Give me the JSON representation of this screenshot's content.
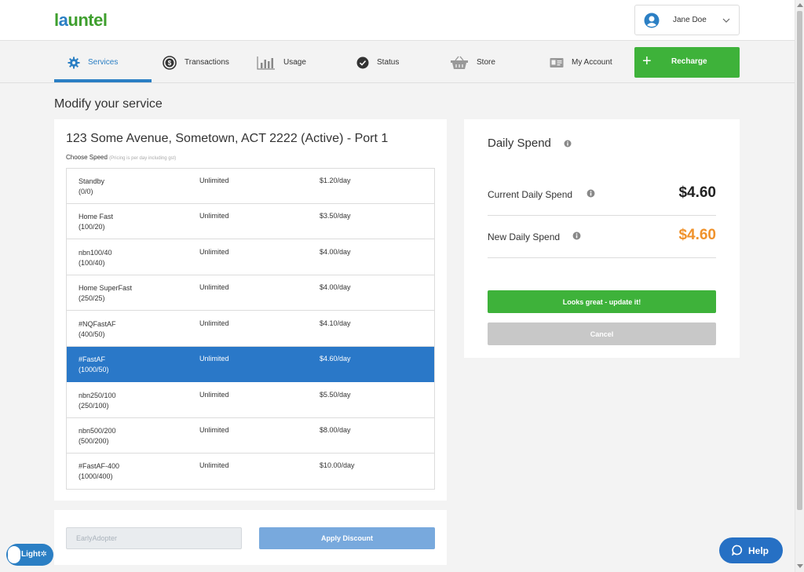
{
  "app": {
    "logo_l": "l",
    "logo_u": "a",
    "logo_rest": "untel"
  },
  "user": {
    "name": "Jane Doe"
  },
  "nav": {
    "items": [
      {
        "label": "Services",
        "icon": "gear-icon"
      },
      {
        "label": "Transactions",
        "icon": "dollar-icon"
      },
      {
        "label": "Usage",
        "icon": "bar-chart-icon"
      },
      {
        "label": "Status",
        "icon": "check-circle-icon"
      },
      {
        "label": "Store",
        "icon": "basket-icon"
      },
      {
        "label": "My Account",
        "icon": "id-card-icon"
      }
    ],
    "recharge_label": "Recharge"
  },
  "page": {
    "title": "Modify your service"
  },
  "service": {
    "address": "123 Some Avenue, Sometown, ACT 2222 (Active) - Port 1",
    "choose_label": "Choose Speed",
    "choose_note": "(Pricing is per day including gst)",
    "speeds": [
      {
        "name": "Standby",
        "speed": "(0/0)",
        "limit": "Unlimited",
        "price": "$1.20/day",
        "selected": false
      },
      {
        "name": "Home Fast",
        "speed": "(100/20)",
        "limit": "Unlimited",
        "price": "$3.50/day",
        "selected": false
      },
      {
        "name": "nbn100/40",
        "speed": "(100/40)",
        "limit": "Unlimited",
        "price": "$4.00/day",
        "selected": false
      },
      {
        "name": "Home SuperFast",
        "speed": "(250/25)",
        "limit": "Unlimited",
        "price": "$4.00/day",
        "selected": false
      },
      {
        "name": "#NQFastAF",
        "speed": "(400/50)",
        "limit": "Unlimited",
        "price": "$4.10/day",
        "selected": false
      },
      {
        "name": "#FastAF",
        "speed": "(1000/50)",
        "limit": "Unlimited",
        "price": "$4.60/day",
        "selected": true
      },
      {
        "name": "nbn250/100",
        "speed": "(250/100)",
        "limit": "Unlimited",
        "price": "$5.50/day",
        "selected": false
      },
      {
        "name": "nbn500/200",
        "speed": "(500/200)",
        "limit": "Unlimited",
        "price": "$8.00/day",
        "selected": false
      },
      {
        "name": "#FastAF-400",
        "speed": "(1000/400)",
        "limit": "Unlimited",
        "price": "$10.00/day",
        "selected": false
      }
    ]
  },
  "discount": {
    "placeholder": "EarlyAdopter",
    "value": "",
    "button_label": "Apply Discount"
  },
  "daily_spend": {
    "title": "Daily Spend",
    "current_label": "Current Daily Spend",
    "current_value": "$4.60",
    "new_label": "New Daily Spend",
    "new_value": "$4.60",
    "update_label": "Looks great - update it!",
    "cancel_label": "Cancel"
  },
  "theme_toggle": {
    "label": "Light"
  },
  "help": {
    "label": "Help"
  },
  "colors": {
    "brand_green": "#3eb23a",
    "brand_blue": "#2b7fc4",
    "selected_row": "#2a78c8",
    "new_spend": "#f0922b",
    "current_spend": "#222222"
  }
}
